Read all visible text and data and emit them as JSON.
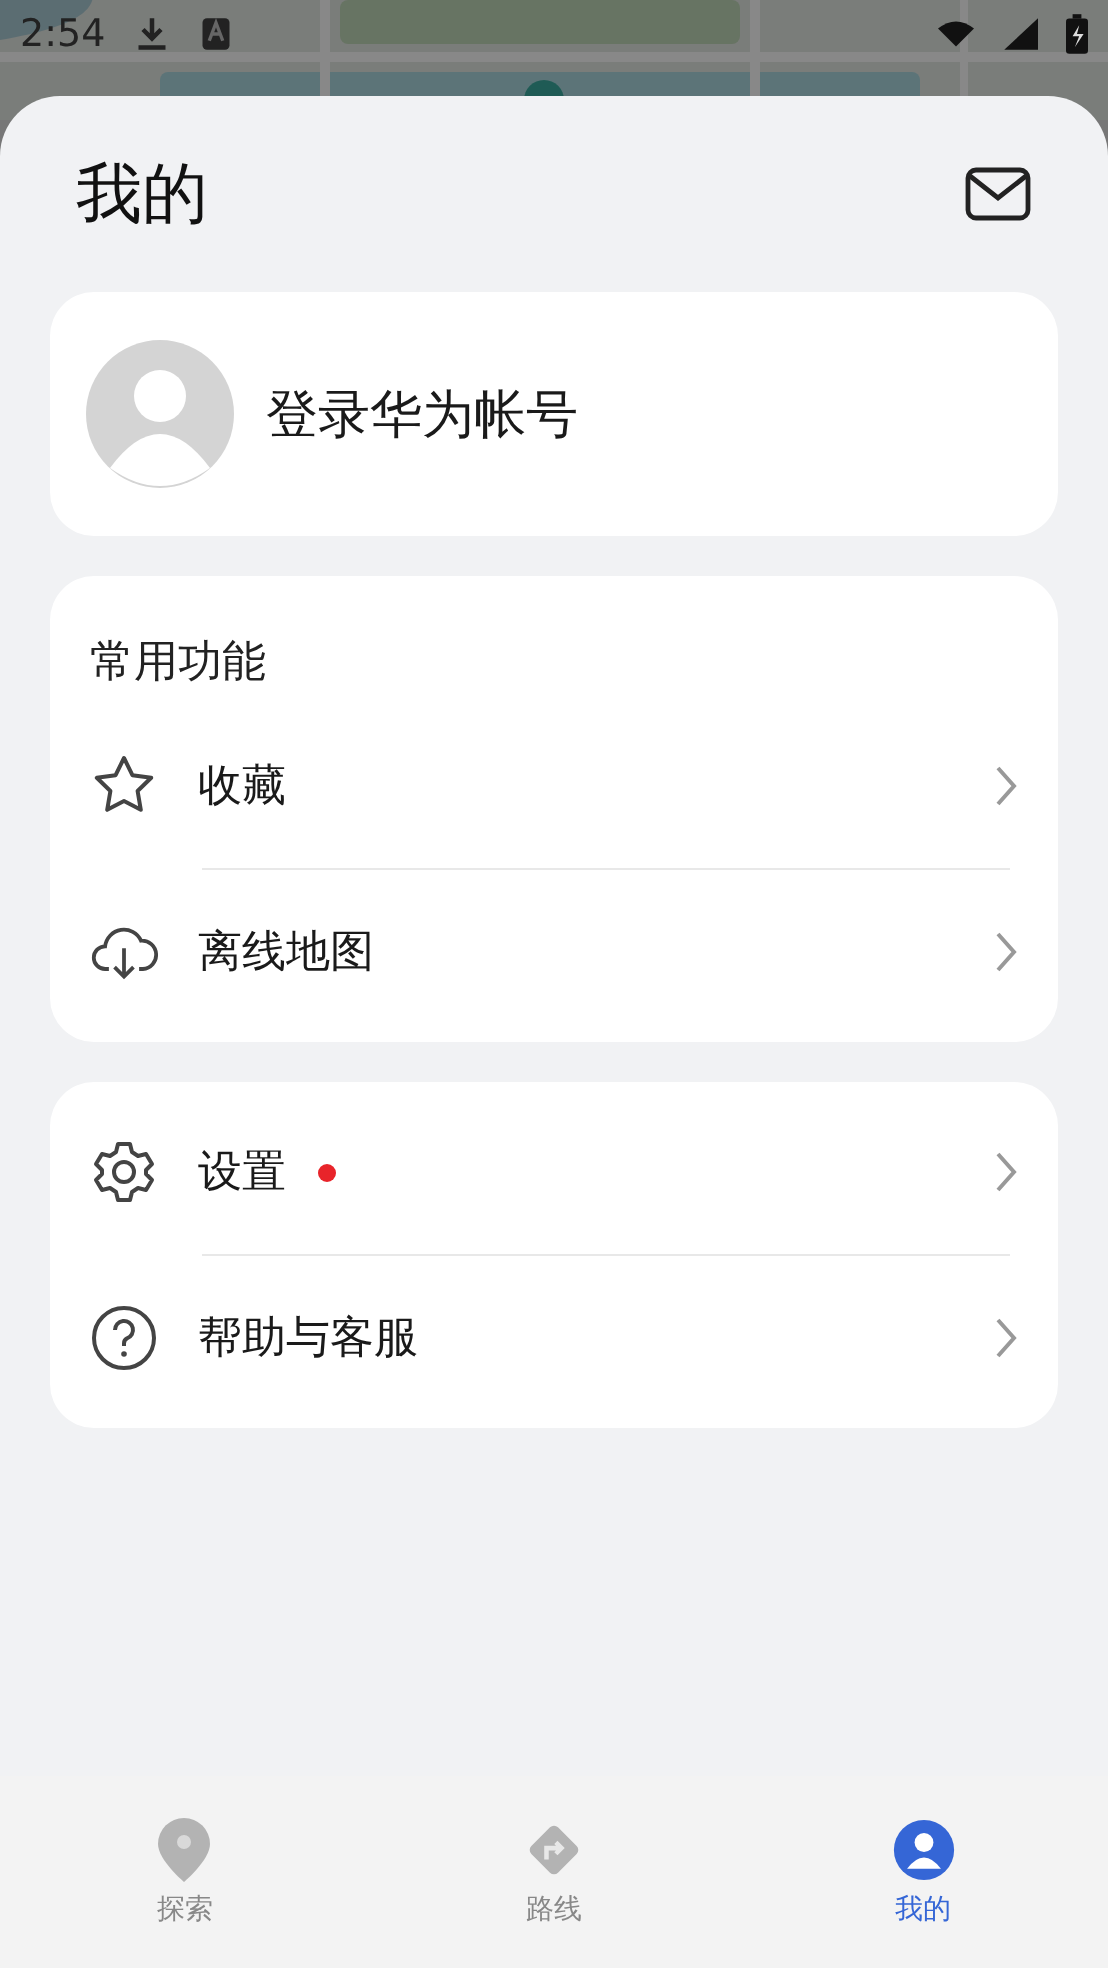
{
  "status_bar": {
    "time": "2:54"
  },
  "header": {
    "title": "我的"
  },
  "profile": {
    "login_label": "登录华为帐号"
  },
  "sections": [
    {
      "title": "常用功能",
      "items": [
        {
          "kind": "star",
          "label": "收藏",
          "dot": false
        },
        {
          "kind": "cloud",
          "label": "离线地图",
          "dot": false
        }
      ]
    },
    {
      "items": [
        {
          "kind": "gear",
          "label": "设置",
          "dot": true
        },
        {
          "kind": "help",
          "label": "帮助与客服",
          "dot": false
        }
      ]
    }
  ],
  "tabs": [
    {
      "kind": "pin",
      "label": "探索",
      "selected": false
    },
    {
      "kind": "route",
      "label": "路线",
      "selected": false
    },
    {
      "kind": "user",
      "label": "我的",
      "selected": true
    }
  ]
}
